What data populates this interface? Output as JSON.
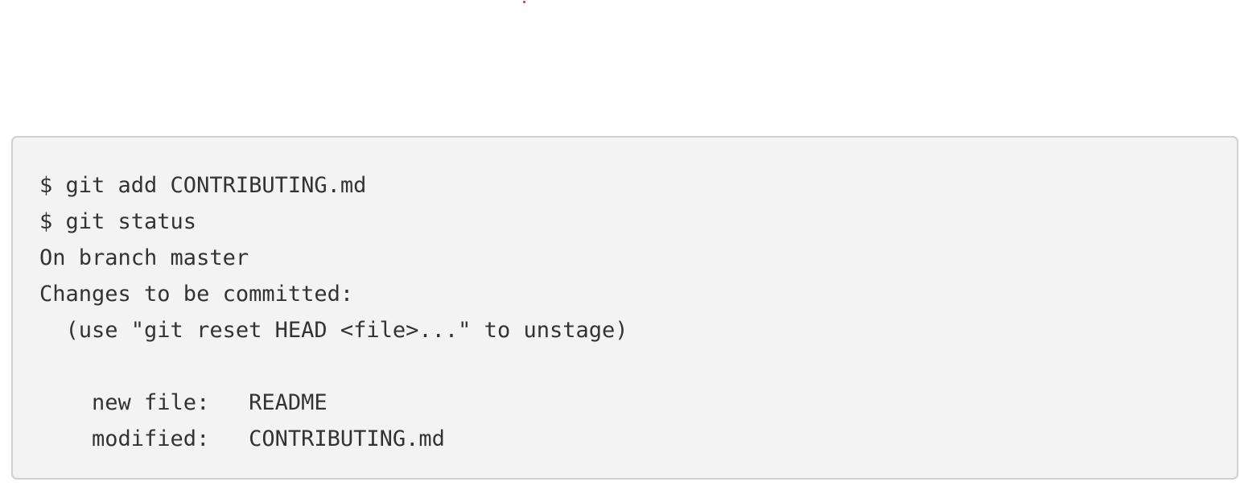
{
  "terminal": {
    "lines": [
      "$ git add CONTRIBUTING.md",
      "$ git status",
      "On branch master",
      "Changes to be committed:",
      "  (use \"git reset HEAD <file>...\" to unstage)",
      "",
      "    new file:   README",
      "    modified:   CONTRIBUTING.md"
    ]
  },
  "colors": {
    "block_background": "#f3f3f3",
    "block_border": "#d0d0d0",
    "text": "#333333",
    "marker": "#c0392b"
  }
}
